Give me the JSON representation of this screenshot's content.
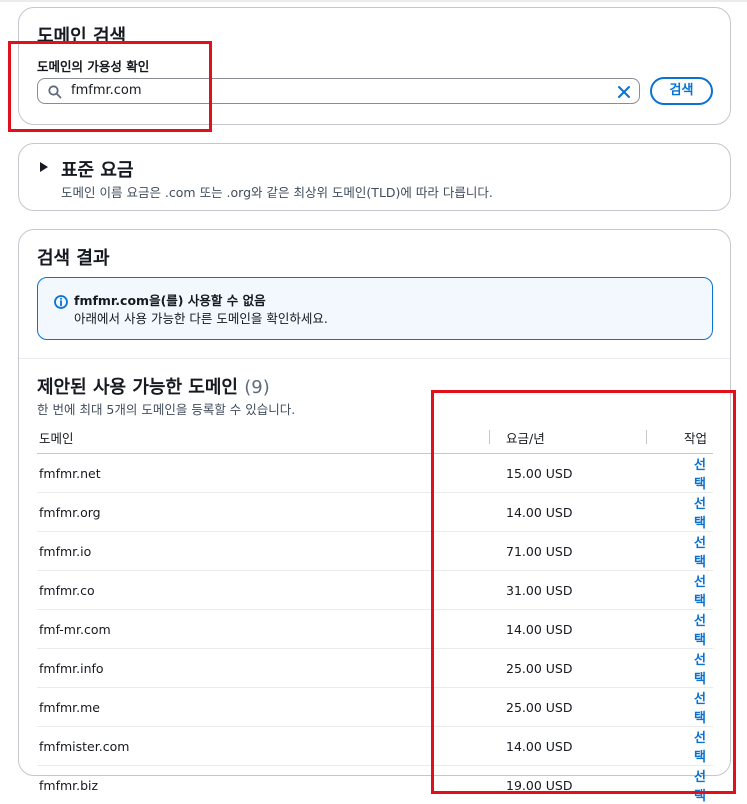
{
  "search_panel": {
    "title": "도메인 검색",
    "field_label": "도메인의 가용성 확인",
    "query": "fmfmr.com",
    "search_button": "검색"
  },
  "pricing_panel": {
    "title": "표준 요금",
    "description": "도메인 이름 요금은 .com 또는 .org와 같은 최상위 도메인(TLD)에 따라 다릅니다."
  },
  "results_panel": {
    "title": "검색 결과",
    "alert": {
      "domain": "fmfmr.com",
      "message_tail": "을(를) 사용할 수 없음",
      "sub": "아래에서 사용 가능한 다른 도메인을 확인하세요."
    },
    "suggested": {
      "title": "제안된 사용 가능한 도메인",
      "count": "(9)",
      "subtitle": "한 번에 최대 5개의 도메인을 등록할 수 있습니다.",
      "columns": [
        "도메인",
        "요금/년",
        "작업"
      ],
      "rows": [
        {
          "domain": "fmfmr.net",
          "price": "15.00 USD",
          "action": "선택"
        },
        {
          "domain": "fmfmr.org",
          "price": "14.00 USD",
          "action": "선택"
        },
        {
          "domain": "fmfmr.io",
          "price": "71.00 USD",
          "action": "선택"
        },
        {
          "domain": "fmfmr.co",
          "price": "31.00 USD",
          "action": "선택"
        },
        {
          "domain": "fmf-mr.com",
          "price": "14.00 USD",
          "action": "선택"
        },
        {
          "domain": "fmfmr.info",
          "price": "25.00 USD",
          "action": "선택"
        },
        {
          "domain": "fmfmr.me",
          "price": "25.00 USD",
          "action": "선택"
        },
        {
          "domain": "fmfmister.com",
          "price": "14.00 USD",
          "action": "선택"
        },
        {
          "domain": "fmfmr.biz",
          "price": "19.00 USD",
          "action": "선택"
        }
      ]
    }
  },
  "colors": {
    "link": "#0972d3",
    "highlight": "#e0111b",
    "alert_bg": "#f2f8fd"
  },
  "icons": [
    "search-icon",
    "clear-icon",
    "caret-right-icon",
    "info-icon"
  ]
}
